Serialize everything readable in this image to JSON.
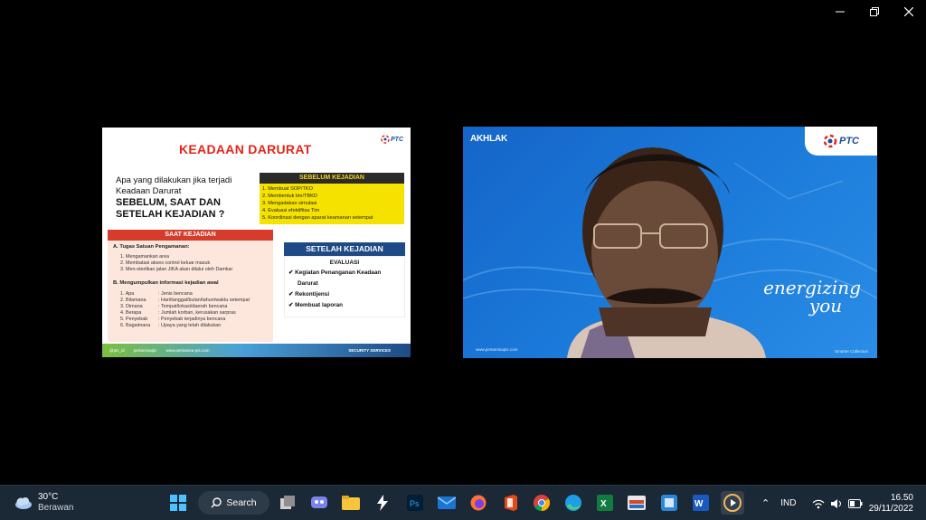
{
  "window_controls": {
    "minimize": "minimize-icon",
    "maximize": "restore-icon",
    "close": "close-icon"
  },
  "slide": {
    "title": "KEADAAN DARURAT",
    "logo_text": "PTC",
    "question_line1": "Apa yang dilakukan jika terjadi",
    "question_line2": "Keadaan Darurat",
    "question_line3": "SEBELUM, SAAT DAN",
    "question_line4": "SETELAH KEJADIAN ?",
    "sebelum": {
      "title": "SEBELUM KEJADIAN",
      "items": [
        "1.    Membuat SOP/TKO",
        "2.    Membentuk tim/TBKD",
        "3.    Mengadakan simulasi",
        "4.    Evaluasi efektifitas Tim",
        "5.    Koordinasi dengan aparat keamanan setempat"
      ]
    },
    "saat": {
      "title": "SAAT  KEJADIAN",
      "a_head": "A. Tugas Satuan Pengamanan:",
      "a_items": [
        "1.   Mengamankan area",
        "2.   Membatasi akses control keluar masuk",
        "3.   Men-sterilkan jalan JIKA akan dilalui oleh Damkar"
      ],
      "b_head": "B. Mengumpulkan informasi kejadian awal",
      "b_rows": [
        {
          "k": "1. Apa",
          "v": ": Jenis bencana"
        },
        {
          "k": "2. Bilamana",
          "v": ": Hari/tanggal/bulan/tahun/waktu setempat"
        },
        {
          "k": "3. Dimana",
          "v": ": Tempat/lokasi/daerah bencana"
        },
        {
          "k": "4. Berapa",
          "v": ": Jumlah korban, kerusakan sarpras"
        },
        {
          "k": "5. Penyebab",
          "v": ": Penyebab terjadinya bencana"
        },
        {
          "k": "6. Bagaimana",
          "v": ": Upaya yang telah dilakukan"
        }
      ]
    },
    "setelah": {
      "title": "SETELAH KEJADIAN",
      "eval": "EVALUASI",
      "items": [
        "✔  Kegiatan Penanganan Keadaan",
        "    Darurat",
        "✔  Rekontijensi",
        "✔  Membuat laporan"
      ]
    },
    "footer": {
      "a": "@ptc_id",
      "b": "pertaminaptc",
      "c": "www.pertamina-ptc.com",
      "d": "SECURITY SERVICES"
    }
  },
  "camera": {
    "akhlak": "AKHLAK",
    "logo_text": "PTC",
    "slogan_1": "energizing",
    "slogan_2": "you",
    "url": "www.pertaminaptc.com",
    "right": "Smarter Collection"
  },
  "taskbar": {
    "weather_temp": "30°C",
    "weather_desc": "Berawan",
    "search_label": "Search",
    "lang": "IND",
    "time": "16.50",
    "date": "29/11/2022"
  },
  "colors": {
    "title_red": "#e3261b",
    "navy": "#1e4a86",
    "yellow": "#f6e200",
    "taskbar": "#1b2836"
  }
}
